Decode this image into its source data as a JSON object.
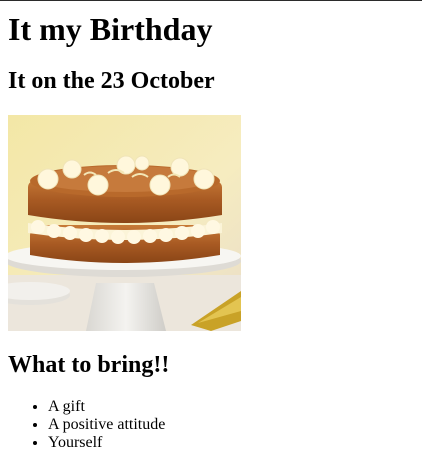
{
  "page": {
    "heading": "It my Birthday",
    "date_heading": "It on the 23 October",
    "image": {
      "subject": "cake-photo"
    },
    "bring_heading": "What to bring!!",
    "bring_items": [
      "A gift",
      "A positive attitude",
      "Yourself"
    ]
  }
}
